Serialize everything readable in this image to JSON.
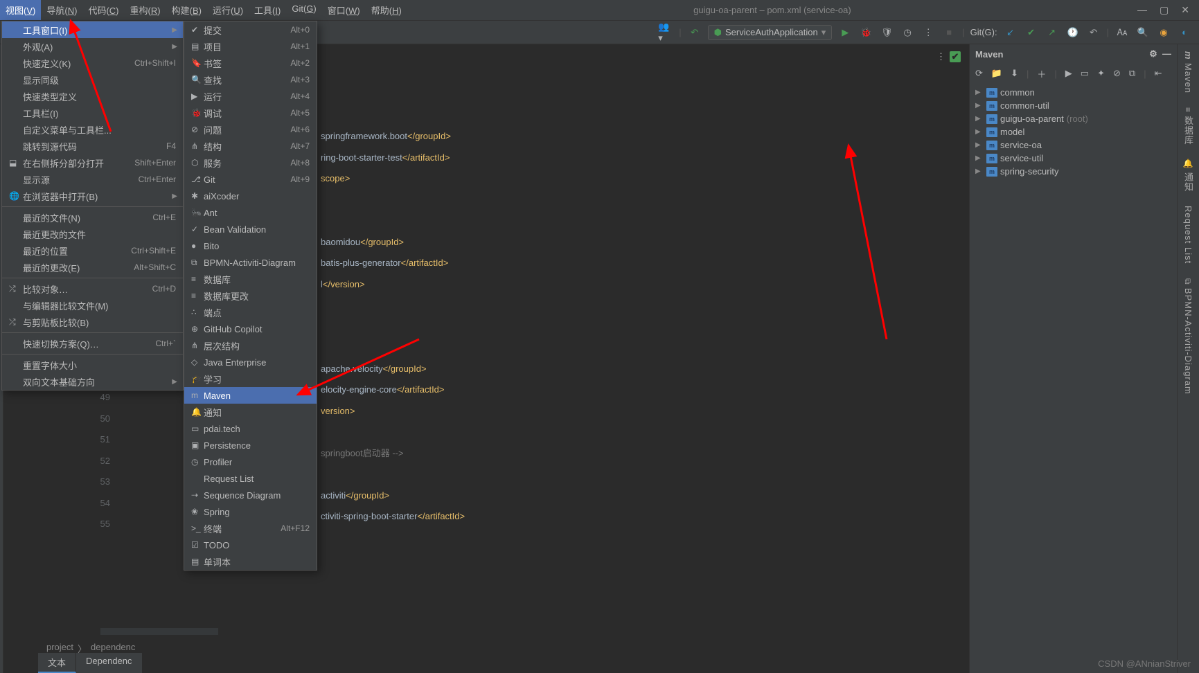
{
  "window": {
    "title": "guigu-oa-parent – pom.xml (service-oa)"
  },
  "menubar": [
    "视图(V)",
    "导航(N)",
    "代码(C)",
    "重构(R)",
    "构建(B)",
    "运行(U)",
    "工具(I)",
    "Git(G)",
    "窗口(W)",
    "帮助(H)"
  ],
  "run_config": "ServiceAuthApplication",
  "git_label": "Git(G):",
  "submenu1": [
    {
      "label": "工具窗口(I)",
      "shortcut": "",
      "selected": true,
      "arrow": true
    },
    {
      "label": "外观(A)",
      "shortcut": "",
      "arrow": true
    },
    {
      "label": "快速定义(K)",
      "shortcut": "Ctrl+Shift+I"
    },
    {
      "label": "显示同级",
      "shortcut": ""
    },
    {
      "label": "快速类型定义",
      "shortcut": ""
    },
    {
      "label": "工具栏(I)",
      "shortcut": ""
    },
    {
      "label": "自定义菜单与工具栏...",
      "shortcut": ""
    },
    {
      "label": "跳转到源代码",
      "shortcut": "F4"
    },
    {
      "label": "在右侧拆分部分打开",
      "shortcut": "Shift+Enter",
      "icon": "⬓"
    },
    {
      "label": "显示源",
      "shortcut": "Ctrl+Enter"
    },
    {
      "label": "在浏览器中打开(B)",
      "shortcut": "",
      "icon": "🌐",
      "arrow": true
    },
    {
      "sep": true
    },
    {
      "label": "最近的文件(N)",
      "shortcut": "Ctrl+E"
    },
    {
      "label": "最近更改的文件",
      "shortcut": ""
    },
    {
      "label": "最近的位置",
      "shortcut": "Ctrl+Shift+E"
    },
    {
      "label": "最近的更改(E)",
      "shortcut": "Alt+Shift+C"
    },
    {
      "sep": true
    },
    {
      "label": "比较对象…",
      "shortcut": "Ctrl+D",
      "icon": "⤮"
    },
    {
      "label": "与编辑器比较文件(M)",
      "shortcut": ""
    },
    {
      "label": "与剪贴板比较(B)",
      "shortcut": "",
      "icon": "⤮"
    },
    {
      "sep": true
    },
    {
      "label": "快速切换方案(Q)…",
      "shortcut": "Ctrl+`"
    },
    {
      "sep": true
    },
    {
      "label": "重置字体大小",
      "shortcut": ""
    },
    {
      "label": "双向文本基础方向",
      "shortcut": "",
      "arrow": true
    }
  ],
  "submenu2": [
    {
      "label": "提交",
      "shortcut": "Alt+0",
      "icon": "✔"
    },
    {
      "label": "项目",
      "shortcut": "Alt+1",
      "icon": "▤"
    },
    {
      "label": "书签",
      "shortcut": "Alt+2",
      "icon": "🔖"
    },
    {
      "label": "查找",
      "shortcut": "Alt+3",
      "icon": "🔍"
    },
    {
      "label": "运行",
      "shortcut": "Alt+4",
      "icon": "▶"
    },
    {
      "label": "调试",
      "shortcut": "Alt+5",
      "icon": "🐞"
    },
    {
      "label": "问题",
      "shortcut": "Alt+6",
      "icon": "⊘"
    },
    {
      "label": "结构",
      "shortcut": "Alt+7",
      "icon": "⋔"
    },
    {
      "label": "服务",
      "shortcut": "Alt+8",
      "icon": "⬡"
    },
    {
      "label": "Git",
      "shortcut": "Alt+9",
      "icon": "⎇"
    },
    {
      "label": "aiXcoder",
      "icon": "✱"
    },
    {
      "label": "Ant",
      "icon": "🐜"
    },
    {
      "label": "Bean Validation",
      "icon": "✓"
    },
    {
      "label": "Bito",
      "icon": "●"
    },
    {
      "label": "BPMN-Activiti-Diagram",
      "icon": "⧉"
    },
    {
      "label": "数据库",
      "icon": "≡"
    },
    {
      "label": "数据库更改",
      "icon": "≡"
    },
    {
      "label": "端点",
      "icon": "∴"
    },
    {
      "label": "GitHub Copilot",
      "icon": "⊕"
    },
    {
      "label": "层次结构",
      "icon": "⋔"
    },
    {
      "label": "Java Enterprise",
      "icon": "◇"
    },
    {
      "label": "学习",
      "icon": "🎓"
    },
    {
      "label": "Maven",
      "icon": "m",
      "selected": true
    },
    {
      "label": "通知",
      "icon": "🔔"
    },
    {
      "label": "pdai.tech",
      "icon": "▭"
    },
    {
      "label": "Persistence",
      "icon": "▣"
    },
    {
      "label": "Profiler",
      "icon": "◷"
    },
    {
      "label": "Request List",
      "icon": ""
    },
    {
      "label": "Sequence Diagram",
      "icon": "⇢"
    },
    {
      "label": "Spring",
      "icon": "❀"
    },
    {
      "label": "终端",
      "shortcut": "Alt+F12",
      "icon": ">_"
    },
    {
      "label": "TODO",
      "icon": "☑"
    },
    {
      "label": "单词本",
      "icon": "▤"
    }
  ],
  "gutter": [
    "49",
    "50",
    "51",
    "52",
    "53",
    "54",
    "55"
  ],
  "code": [
    [
      {
        "t": "springframework.boot",
        "c": "val"
      },
      {
        "t": "</",
        "c": "tag"
      },
      {
        "t": "groupId",
        "c": "tag"
      },
      {
        "t": ">",
        "c": "tag"
      }
    ],
    [
      {
        "t": "ring-boot-starter-test",
        "c": "val"
      },
      {
        "t": "</",
        "c": "tag"
      },
      {
        "t": "artifactId",
        "c": "tag"
      },
      {
        "t": ">",
        "c": "tag"
      }
    ],
    [
      {
        "t": "scope",
        "c": "tag"
      },
      {
        "t": ">",
        "c": "tag"
      }
    ],
    [
      {
        "t": ""
      }
    ],
    [
      {
        "t": ""
      }
    ],
    [
      {
        "t": "baomidou",
        "c": "val"
      },
      {
        "t": "</",
        "c": "tag"
      },
      {
        "t": "groupId",
        "c": "tag"
      },
      {
        "t": ">",
        "c": "tag"
      }
    ],
    [
      {
        "t": "batis-plus-generator",
        "c": "val"
      },
      {
        "t": "</",
        "c": "tag"
      },
      {
        "t": "artifactId",
        "c": "tag"
      },
      {
        "t": ">",
        "c": "tag"
      }
    ],
    [
      {
        "t": "l",
        "c": "val"
      },
      {
        "t": "</",
        "c": "tag"
      },
      {
        "t": "version",
        "c": "tag"
      },
      {
        "t": ">",
        "c": "tag"
      }
    ],
    [
      {
        "t": ""
      }
    ],
    [
      {
        "t": ""
      }
    ],
    [
      {
        "t": ""
      }
    ],
    [
      {
        "t": "apache.velocity",
        "c": "val"
      },
      {
        "t": "</",
        "c": "tag"
      },
      {
        "t": "groupId",
        "c": "tag"
      },
      {
        "t": ">",
        "c": "tag"
      }
    ],
    [
      {
        "t": "elocity-engine-core",
        "c": "val"
      },
      {
        "t": "</",
        "c": "tag"
      },
      {
        "t": "artifactId",
        "c": "tag"
      },
      {
        "t": ">",
        "c": "tag"
      }
    ],
    [
      {
        "t": "version",
        "c": "tag"
      },
      {
        "t": ">",
        "c": "tag"
      }
    ],
    [
      {
        "t": ""
      }
    ],
    [
      {
        "t": "springboot启动器 -->",
        "c": "dim"
      }
    ],
    [
      {
        "t": ""
      }
    ],
    [
      {
        "t": "activiti",
        "c": "val"
      },
      {
        "t": "</",
        "c": "tag"
      },
      {
        "t": "groupId",
        "c": "tag"
      },
      {
        "t": ">",
        "c": "tag"
      }
    ],
    [
      {
        "t": "ctiviti-spring-boot-starter",
        "c": "val"
      },
      {
        "t": "</",
        "c": "tag"
      },
      {
        "t": "artifactId",
        "c": "tag"
      },
      {
        "t": ">",
        "c": "tag"
      }
    ]
  ],
  "breadcrumb": [
    "project",
    "dependenc"
  ],
  "editor_tabs": [
    "文本",
    "Dependenc"
  ],
  "maven": {
    "title": "Maven",
    "items": [
      {
        "name": "common"
      },
      {
        "name": "common-util"
      },
      {
        "name": "guigu-oa-parent",
        "suffix": "(root)"
      },
      {
        "name": "model"
      },
      {
        "name": "service-oa"
      },
      {
        "name": "service-util"
      },
      {
        "name": "spring-security"
      }
    ]
  },
  "right_tabs": [
    "Maven",
    "数据库",
    "通知",
    "Request List",
    "BPMN-Activiti-Diagram"
  ],
  "watermark": "CSDN @ANnianStriver"
}
